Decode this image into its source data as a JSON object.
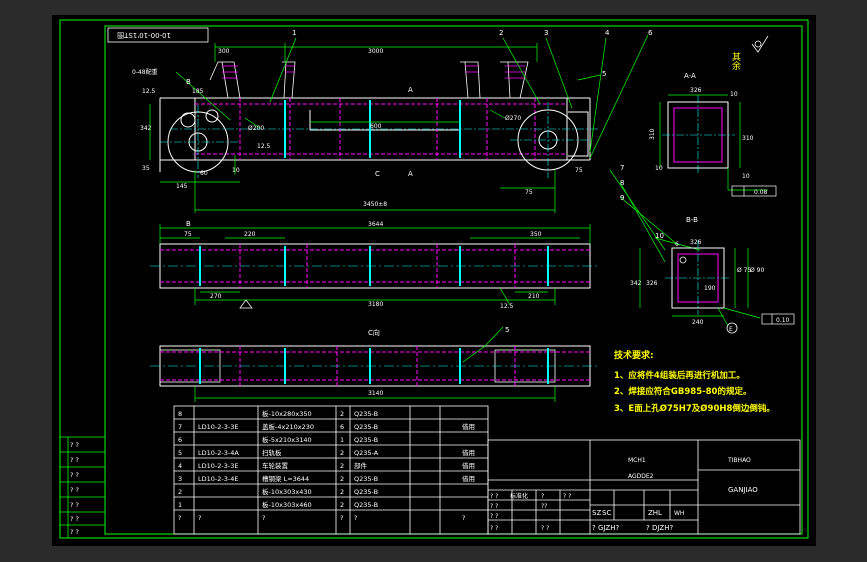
{
  "colors": {
    "outer_bg": "#2b2b2b",
    "sheet_bg": "#000000",
    "frame_line": "#00ff00",
    "outline": "#ffffff",
    "hidden": "#ff00ff",
    "center": "#00ffff",
    "dim": "#00ff00",
    "text_yellow": "#ffff00",
    "text_white": "#ffffff",
    "leader": "#00ff00"
  },
  "drawing": {
    "top_left_tag": "10-00-10'1ST图",
    "balloons": [
      "1",
      "2",
      "3",
      "4",
      "5",
      "6",
      "7",
      "8",
      "9",
      "10"
    ],
    "view_titles": {
      "aa": "A-A",
      "bb": "B-B",
      "c": "C向"
    },
    "section_marks": [
      "A",
      "A",
      "B",
      "B",
      "C"
    ],
    "dims_front": [
      "300",
      "3000",
      "600",
      "3450±8",
      "145",
      "60",
      "10",
      "35",
      "Ø200",
      "Ø270",
      "185",
      "75",
      "12.5",
      "0-48配重",
      "12.5",
      "342",
      "75"
    ],
    "dims_plan": [
      "3644",
      "75",
      "220",
      "350",
      "270",
      "210",
      "3180",
      "12.5"
    ],
    "dims_c": [
      "3140"
    ],
    "dims_aa": [
      "326",
      "310",
      "310",
      "10",
      "10",
      "10"
    ],
    "gd_aa": "0.08",
    "dims_bb": [
      "6",
      "342",
      "326",
      "190",
      "Ø 75",
      "Ø 90",
      "326",
      "240"
    ],
    "gd_bb": "0.10",
    "datum": "E",
    "surface_finish": "其余",
    "tech_title": "技术要求:",
    "tech_notes": [
      "1、应将件4组装后再进行机加工。",
      "2、焊接应符合GB985-80的规定。",
      "3、E面上孔Ø75H7及Ø90H8倒边倒钝。"
    ]
  },
  "bom": {
    "rows": [
      {
        "no": "8",
        "code": "",
        "name": "板-10x280x350",
        "qty": "2",
        "mat": "Q235-B",
        "note": ""
      },
      {
        "no": "7",
        "code": "LD10-2-3-3E",
        "name": "盖板-4x210x230",
        "qty": "6",
        "mat": "Q235-B",
        "note": "借用"
      },
      {
        "no": "6",
        "code": "",
        "name": "板-5x210x3140",
        "qty": "1",
        "mat": "Q235-B",
        "note": ""
      },
      {
        "no": "5",
        "code": "LD10-2-3-4A",
        "name": "扫轨板",
        "qty": "2",
        "mat": "Q235-A",
        "note": "借用"
      },
      {
        "no": "4",
        "code": "LD10-2-3-3E",
        "name": "车轮装置",
        "qty": "2",
        "mat": "部件",
        "note": "借用"
      },
      {
        "no": "3",
        "code": "LD10-2-3-4E",
        "name": "槽钢梁 L=3644",
        "qty": "2",
        "mat": "Q235-B",
        "note": "借用"
      },
      {
        "no": "2",
        "code": "",
        "name": "板-10x303x430",
        "qty": "2",
        "mat": "Q235-B",
        "note": ""
      },
      {
        "no": "1",
        "code": "",
        "name": "板-10x303x460",
        "qty": "2",
        "mat": "Q235-B",
        "note": ""
      },
      {
        "no": "?",
        "code": "?",
        "name": "?",
        "qty": "?",
        "mat": "?",
        "note": "?"
      }
    ],
    "header_q": [
      "?",
      "?",
      "?",
      "?",
      "?",
      "?"
    ]
  },
  "title_block": {
    "mark_tl": "MCH1",
    "mark_ml": "AGDDE2",
    "company": "TIBHAO",
    "drawing_no": "GANJIAO",
    "labels": [
      "? ?",
      "?",
      "? ?",
      "? ?",
      "??",
      "? ?",
      "? ?",
      "? ?"
    ],
    "l1": "标准化",
    "roles": [
      "SZ",
      "SC",
      "ZHL",
      "WH"
    ],
    "sig1": "? GJZH?",
    "sig2": "? DJZH?"
  },
  "left_strip": {
    "cells": [
      "? ?",
      "? ?",
      "? ?",
      "? ?",
      "? ?",
      "? ?",
      "? ?"
    ]
  }
}
